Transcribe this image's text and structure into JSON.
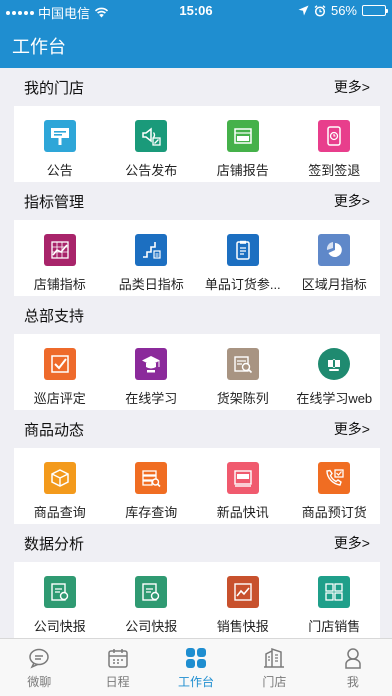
{
  "status": {
    "carrier": "中国电信",
    "time": "15:06",
    "battery": "56%",
    "battery_level": 0.56
  },
  "header": {
    "title": "工作台"
  },
  "sections": [
    {
      "title": "我的门店",
      "more": "更多>",
      "items": [
        {
          "label": "公告",
          "icon": "billboard-icon",
          "color": "#2ea6d8"
        },
        {
          "label": "公告发布",
          "icon": "announce-publish-icon",
          "color": "#1a9a7a"
        },
        {
          "label": "店铺报告",
          "icon": "store-report-icon",
          "color": "#45b14a"
        },
        {
          "label": "签到签退",
          "icon": "checkin-clock-icon",
          "color": "#e83e8c"
        }
      ]
    },
    {
      "title": "指标管理",
      "more": "更多>",
      "items": [
        {
          "label": "店铺指标",
          "icon": "store-kpi-icon",
          "color": "#a8246a"
        },
        {
          "label": "品类日指标",
          "icon": "category-daily-icon",
          "color": "#1c6fc1"
        },
        {
          "label": "单品订货参...",
          "icon": "sku-order-icon",
          "color": "#1c6fc1"
        },
        {
          "label": "区域月指标",
          "icon": "region-month-icon",
          "color": "#5f88c9"
        }
      ]
    },
    {
      "title": "总部支持",
      "more": "",
      "items": [
        {
          "label": "巡店评定",
          "icon": "inspection-check-icon",
          "color": "#ee6a2b"
        },
        {
          "label": "在线学习",
          "icon": "graduation-cap-icon",
          "color": "#8b2a9b"
        },
        {
          "label": "货架陈列",
          "icon": "shelf-display-icon",
          "color": "#a89482"
        },
        {
          "label": "在线学习web",
          "icon": "online-learning-web-icon",
          "color": "#1f8a70"
        }
      ]
    },
    {
      "title": "商品动态",
      "more": "更多>",
      "items": [
        {
          "label": "商品查询",
          "icon": "product-box-icon",
          "color": "#f39a1c"
        },
        {
          "label": "库存查询",
          "icon": "inventory-search-icon",
          "color": "#f06d22"
        },
        {
          "label": "新品快讯",
          "icon": "new-product-icon",
          "color": "#f05a6e"
        },
        {
          "label": "商品预订货",
          "icon": "preorder-icon",
          "color": "#f06d22"
        }
      ]
    },
    {
      "title": "数据分析",
      "more": "更多>",
      "items": [
        {
          "label": "公司快报",
          "icon": "company-report-icon",
          "color": "#2f9a72"
        },
        {
          "label": "公司快报",
          "icon": "company-report-icon",
          "color": "#2f9a72"
        },
        {
          "label": "销售快报",
          "icon": "sales-report-icon",
          "color": "#c8512d"
        },
        {
          "label": "门店销售",
          "icon": "store-sales-icon",
          "color": "#1f9f8a"
        }
      ]
    }
  ],
  "tabs": [
    {
      "label": "微聊",
      "icon": "chat-bubble-icon",
      "active": false
    },
    {
      "label": "日程",
      "icon": "calendar-icon",
      "active": false
    },
    {
      "label": "工作台",
      "icon": "workbench-grid-icon",
      "active": true
    },
    {
      "label": "门店",
      "icon": "store-building-icon",
      "active": false
    },
    {
      "label": "我",
      "icon": "person-icon",
      "active": false
    }
  ]
}
